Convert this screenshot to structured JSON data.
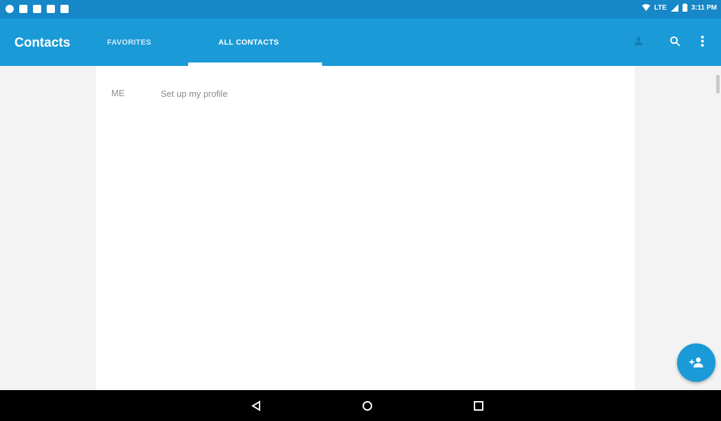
{
  "status_bar": {
    "left_icons": [
      "notification-icon",
      "mail-icon",
      "mail-icon",
      "media-icon",
      "sd-card-icon"
    ],
    "network_label": "LTE",
    "time": "3:11 PM"
  },
  "app_bar": {
    "title": "Contacts",
    "tabs": [
      {
        "label": "FAVORITES",
        "selected": false
      },
      {
        "label": "ALL CONTACTS",
        "selected": true
      }
    ],
    "actions": [
      "person-icon",
      "search-icon",
      "more-vert-icon"
    ]
  },
  "content": {
    "me_label": "ME",
    "profile_setup_text": "Set up my profile"
  },
  "fab": {
    "icon": "person-add-icon"
  },
  "nav_bar": {
    "buttons": [
      "back-icon",
      "home-icon",
      "recents-icon"
    ]
  },
  "colors": {
    "status_bar": "#1687c7",
    "app_bar": "#1b9ad8",
    "accent": "#1b9ad8",
    "background": "#f3f3f3"
  }
}
